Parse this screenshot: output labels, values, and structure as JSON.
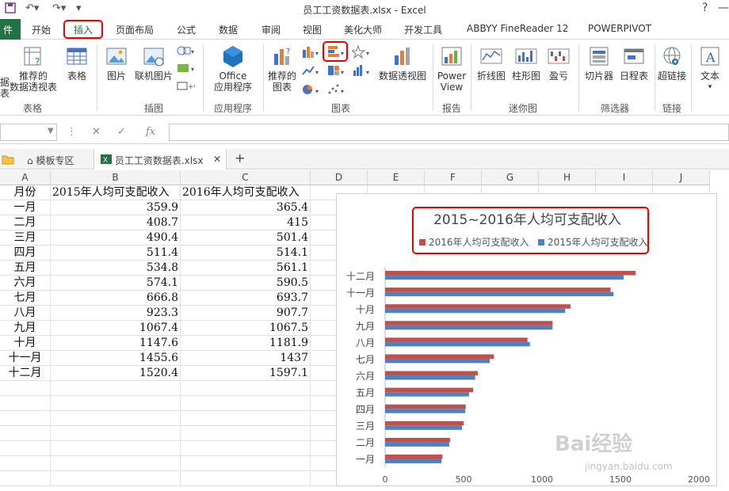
{
  "window": {
    "title": "员工工资数据表.xlsx - Excel",
    "help": "?",
    "minimize": "—"
  },
  "tabs": [
    "件",
    "开始",
    "插入",
    "页面布局",
    "公式",
    "数据",
    "审阅",
    "视图",
    "美化大师",
    "开发工具",
    "ABBYY FineReader 12",
    "POWERPIVOT"
  ],
  "active_tab": "插入",
  "ribbon": {
    "buttons": {
      "recommended_pivot": [
        "推荐的",
        "数据透视表"
      ],
      "table": "表格",
      "picture": "图片",
      "online_picture": "联机图片",
      "office_apps": [
        "Office",
        "应用程序"
      ],
      "recommended_charts": [
        "推荐的",
        "图表"
      ],
      "pivot_chart": "数据透视图",
      "power_view": [
        "Power",
        "View"
      ],
      "line_spark": "折线图",
      "column_spark": "柱形图",
      "winloss_spark": "盈亏",
      "slicer": "切片器",
      "timeline": "日程表",
      "hyperlink": "超链接",
      "text": "文本",
      "left_cut": [
        "据",
        "表"
      ]
    },
    "groups": {
      "tables": "表格",
      "illustrations": "插图",
      "apps": "应用程序",
      "charts": "图表",
      "reports": "报告",
      "sparklines": "迷你图",
      "filters": "筛选器",
      "links": "链接"
    }
  },
  "formula_bar": {
    "fx": "fx",
    "cancel": "✕",
    "enter": "✓",
    "name_box": "",
    "formula": ""
  },
  "workbook_tabs": [
    {
      "label": "模板专区",
      "icon": "home-icon"
    },
    {
      "label": "员工工资数据表.xlsx",
      "icon": "excel-icon"
    }
  ],
  "add_tab": "+",
  "close_tab": "✕",
  "columns": [
    "A",
    "B",
    "C",
    "D",
    "E",
    "F",
    "G",
    "H",
    "I",
    "J"
  ],
  "sheet": {
    "headers": [
      "月份",
      "2015年人均可支配收入",
      "2016年人均可支配收入"
    ],
    "rows": [
      [
        "一月",
        "359.9",
        "365.4"
      ],
      [
        "二月",
        "408.7",
        "415"
      ],
      [
        "三月",
        "490.4",
        "501.4"
      ],
      [
        "四月",
        "511.4",
        "514.1"
      ],
      [
        "五月",
        "534.8",
        "561.1"
      ],
      [
        "六月",
        "574.1",
        "590.5"
      ],
      [
        "七月",
        "666.8",
        "693.7"
      ],
      [
        "八月",
        "923.3",
        "907.7"
      ],
      [
        "九月",
        "1067.4",
        "1067.5"
      ],
      [
        "十月",
        "1147.6",
        "1181.9"
      ],
      [
        "十一月",
        "1455.6",
        "1437"
      ],
      [
        "十二月",
        "1520.4",
        "1597.1"
      ]
    ]
  },
  "chart_data": {
    "type": "bar",
    "orientation": "horizontal",
    "title": "2015~2016年人均可支配收入",
    "categories": [
      "一月",
      "二月",
      "三月",
      "四月",
      "五月",
      "六月",
      "七月",
      "八月",
      "九月",
      "十月",
      "十一月",
      "十二月"
    ],
    "series": [
      {
        "name": "2016年人均可支配收入",
        "color": "#c0504d",
        "values": [
          365.4,
          415,
          501.4,
          514.1,
          561.1,
          590.5,
          693.7,
          907.7,
          1067.5,
          1181.9,
          1437,
          1597.1
        ]
      },
      {
        "name": "2015年人均可支配收入",
        "color": "#4f81bd",
        "values": [
          359.9,
          408.7,
          490.4,
          511.4,
          534.8,
          574.1,
          666.8,
          923.3,
          1067.4,
          1147.6,
          1455.6,
          1520.4
        ]
      }
    ],
    "xticks": [
      "0",
      "500",
      "1000",
      "1500",
      "2000"
    ],
    "xlim": [
      0,
      2000
    ],
    "legend_position": "top",
    "grid": false
  },
  "watermark": {
    "main": "Bai经验",
    "sub": "jingyan.baidu.com"
  }
}
